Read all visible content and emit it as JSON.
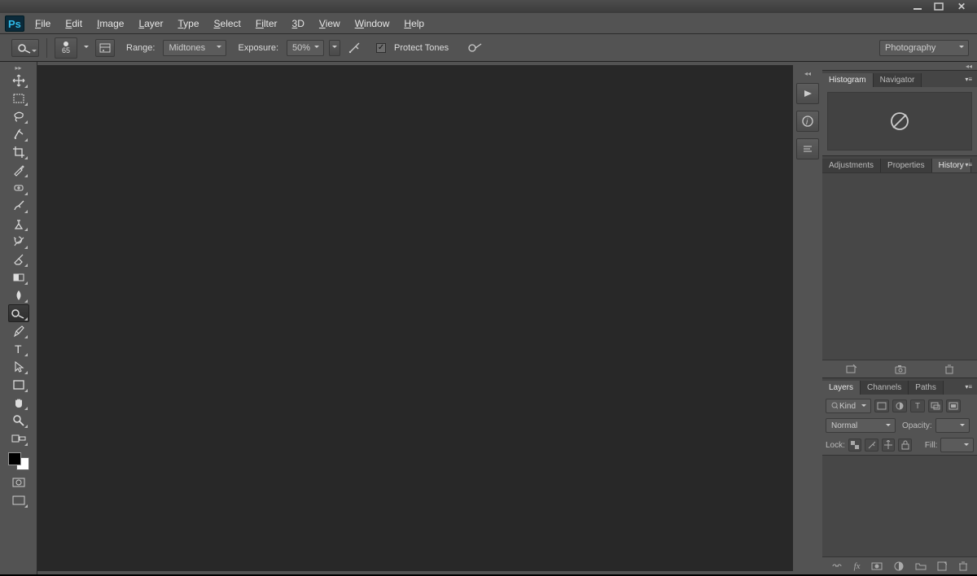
{
  "window": {
    "minimize": "–",
    "maximize": "",
    "close": "✕"
  },
  "menubar": {
    "items": [
      {
        "l": "F",
        "r": "ile"
      },
      {
        "l": "E",
        "r": "dit"
      },
      {
        "l": "I",
        "r": "mage"
      },
      {
        "l": "L",
        "r": "ayer"
      },
      {
        "l": "T",
        "r": "ype"
      },
      {
        "l": "S",
        "r": "elect"
      },
      {
        "l": "Fi",
        "r": "lter"
      },
      {
        "l": "3",
        "r": "D"
      },
      {
        "l": "V",
        "r": "iew"
      },
      {
        "l": "W",
        "r": "indow"
      },
      {
        "l": "H",
        "r": "elp"
      }
    ]
  },
  "optionsbar": {
    "brush_size": "65",
    "labels": {
      "range": "Range:",
      "exposure": "Exposure:",
      "protect": "Protect Tones"
    },
    "range_value": "Midtones",
    "exposure_value": "50%",
    "workspace": "Photography"
  },
  "toolbox": {
    "tools": [
      "move",
      "marquee",
      "lasso",
      "quick-select",
      "crop",
      "eyedropper",
      "healing",
      "brush",
      "clone",
      "history-brush",
      "eraser",
      "gradient",
      "blur",
      "dodge",
      "pen",
      "type",
      "path-select",
      "rectangle",
      "hand",
      "zoom",
      "3d-camera"
    ]
  },
  "panels": {
    "group1": {
      "tabs": [
        "Histogram",
        "Navigator"
      ],
      "active": 0
    },
    "group2": {
      "tabs": [
        "Adjustments",
        "Properties",
        "History"
      ],
      "active": 2
    },
    "group3": {
      "tabs": [
        "Layers",
        "Channels",
        "Paths"
      ],
      "active": 0
    }
  },
  "layers": {
    "filter_label": "Kind",
    "blend_mode": "Normal",
    "opacity_label": "Opacity:",
    "lock_label": "Lock:",
    "fill_label": "Fill:"
  }
}
